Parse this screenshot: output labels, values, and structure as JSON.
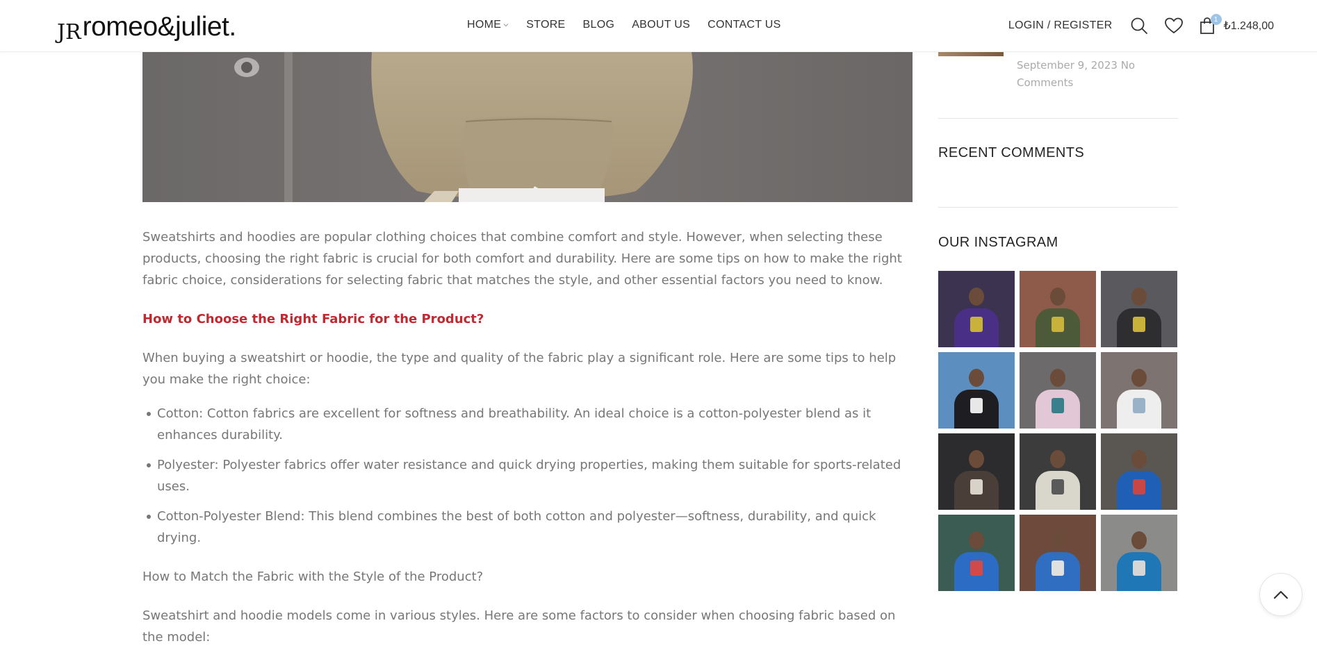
{
  "header": {
    "logo_mark": "JR",
    "logo_text": "romeo&juliet.",
    "nav": [
      {
        "label": "HOME",
        "has_dropdown": true
      },
      {
        "label": "STORE",
        "has_dropdown": false
      },
      {
        "label": "BLOG",
        "has_dropdown": false
      },
      {
        "label": "ABOUT US",
        "has_dropdown": false
      },
      {
        "label": "CONTACT US",
        "has_dropdown": false
      }
    ],
    "login_label": "LOGIN / REGISTER",
    "icons": {
      "search": "search-icon",
      "wishlist": "heart-icon",
      "cart": "shopping-bag-icon"
    },
    "cart_count": "1",
    "cart_total": "₺1.248,00"
  },
  "article": {
    "intro": "Sweatshirts and hoodies are popular clothing choices that combine comfort and style. However, when selecting these products, choosing the right fabric is crucial for both comfort and durability. Here are some tips on how to make the right fabric choice, considerations for selecting fabric that matches the style, and other essential factors you need to know.",
    "heading1": "How to Choose the Right Fabric for the Product?",
    "para2": "When buying a sweatshirt or hoodie, the type and quality of the fabric play a significant role. Here are some tips to help you make the right choice:",
    "list": [
      "Cotton: Cotton fabrics are excellent for softness and breathability. An ideal choice is a cotton-polyester blend as it enhances durability.",
      "Polyester: Polyester fabrics offer water resistance and quick drying properties, making them suitable for sports-related uses.",
      "Cotton-Polyester Blend: This blend combines the best of both cotton and polyester—softness, durability, and quick drying."
    ],
    "heading2": "How to Match the Fabric with the Style of the Product?",
    "para3": "Sweatshirt and hoodie models come in various styles. Here are some factors to consider when choosing fabric based on the model:"
  },
  "sidebar": {
    "recent_post_meta": "September 9, 2023   No Comments",
    "recent_comments_title": "RECENT COMMENTS",
    "instagram_title": "OUR INSTAGRAM",
    "instagram": [
      {
        "bg": "#3b3350",
        "hoodie": "#4a2f86",
        "print": "#c9b23a"
      },
      {
        "bg": "#8e5a4a",
        "hoodie": "#4c5a3a",
        "print": "#c9b23a"
      },
      {
        "bg": "#5a5a5e",
        "hoodie": "#2e2e30",
        "print": "#c9b23a"
      },
      {
        "bg": "#5c8fbf",
        "hoodie": "#1e1e22",
        "print": "#e8e8e8"
      },
      {
        "bg": "#6d6a6c",
        "hoodie": "#e2c7d6",
        "print": "#3a7f8c"
      },
      {
        "bg": "#7d7472",
        "hoodie": "#eeeeee",
        "print": "#9ab2c8"
      },
      {
        "bg": "#2c2c2e",
        "hoodie": "#4a3f38",
        "print": "#d8d2c8"
      },
      {
        "bg": "#3c3c3c",
        "hoodie": "#d9d6cc",
        "print": "#5a5a5a"
      },
      {
        "bg": "#5a5652",
        "hoodie": "#1f5fb5",
        "print": "#c84646"
      },
      {
        "bg": "#3a5c52",
        "hoodie": "#2c6cc4",
        "print": "#d04a4a"
      },
      {
        "bg": "#6d4a3c",
        "hoodie": "#2f6ec0",
        "print": "#e0e0e0"
      },
      {
        "bg": "#8b8b8a",
        "hoodie": "#1f78b5",
        "print": "#d6d6d6"
      }
    ]
  },
  "back_to_top": "chevron-up-icon"
}
